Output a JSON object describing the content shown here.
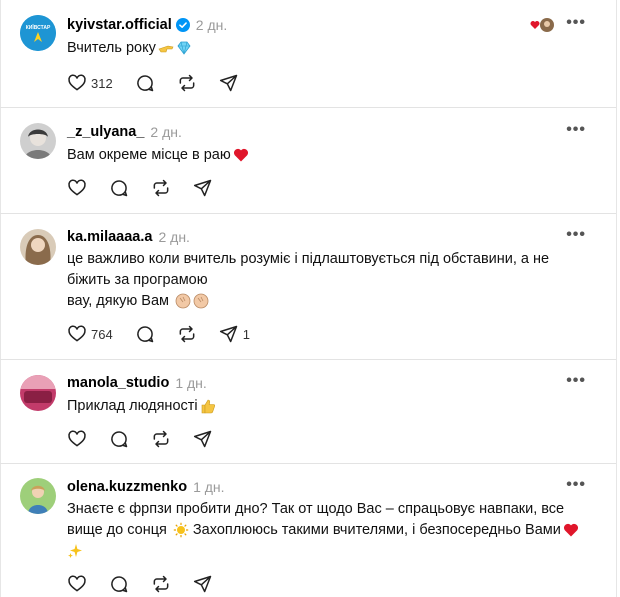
{
  "posts": [
    {
      "username": "kyivstar.official",
      "time": "2 дн.",
      "text": "Вчитель року",
      "likes": "312",
      "shares": ""
    },
    {
      "username": "_z_ulyana_",
      "time": "2 дн.",
      "text": "Вам окреме місце в раю",
      "likes": "",
      "shares": ""
    },
    {
      "username": "ka.milaaaa.a",
      "time": "2 дн.",
      "text_line1": "це важливо коли вчитель розуміє і підлаштовується під обставини, а не",
      "text_line2": "біжить за програмою",
      "text_line3": "вау, дякую Вам",
      "likes": "764",
      "shares": "1"
    },
    {
      "username": "manola_studio",
      "time": "1 дн.",
      "text": "Приклад людяності",
      "likes": "",
      "shares": ""
    },
    {
      "username": "olena.kuzzmenko",
      "time": "1 дн.",
      "text_line1": "Знаєте є фрпзи пробити дно? Так от щодо Вас – спрацьовує навпаки, все",
      "text_line2": "вище до сонця",
      "text_line2b": "Захоплююсь такими вчителями, і безпосередньо Вами",
      "likes": "",
      "shares": ""
    }
  ],
  "icons": {
    "like": "heart-icon",
    "comment": "comment-icon",
    "repost": "repost-icon",
    "share": "share-icon",
    "more": "more-icon"
  },
  "colors": {
    "heart_red": "#e0162b",
    "verified_blue": "#0095f6",
    "muted_text": "#9a9a9a"
  }
}
